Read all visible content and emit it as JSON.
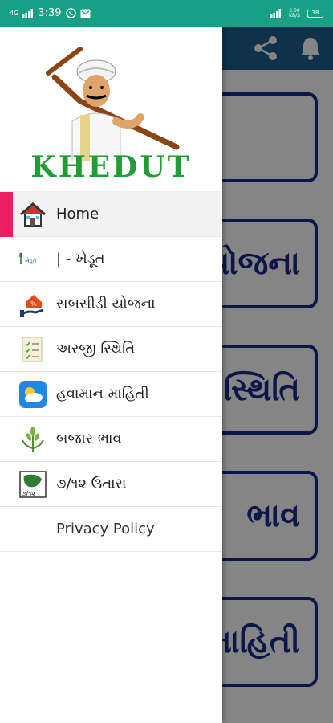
{
  "status_bar": {
    "network": "4G",
    "time": "3:39",
    "data_rate": "2.00 KB/S",
    "battery": "38"
  },
  "drawer": {
    "brand": "KHEDUT",
    "items": [
      {
        "label": "Home",
        "icon": "home-icon",
        "active": true
      },
      {
        "label": "| - ખેડૂત",
        "icon": "ikhedut-logo-icon"
      },
      {
        "label": "સબસીડી યોજના",
        "icon": "subsidy-icon"
      },
      {
        "label": "અરજી સ્થિતિ",
        "icon": "application-status-icon"
      },
      {
        "label": "હવામાન માહિતી",
        "icon": "weather-icon"
      },
      {
        "label": "બજાર ભાવ",
        "icon": "crop-icon"
      },
      {
        "label": "૭/૧૨ ઉતારા",
        "icon": "land-record-icon"
      },
      {
        "label": "Privacy Policy",
        "icon": ""
      }
    ],
    "icon_tiny_text": {
      "ikhedut": "ખેડૂત",
      "land_record": "૭/૧૨"
    }
  },
  "background": {
    "cards": [
      "યોજના",
      "સ્થિતિ",
      "ભાવ",
      "માહિતી"
    ]
  },
  "colors": {
    "status_bar": "#16a085",
    "toolbar": "#1e5f8c",
    "card_border": "#1b2a8c",
    "active_indicator": "#e91e63",
    "brand": "#1e9e34"
  }
}
